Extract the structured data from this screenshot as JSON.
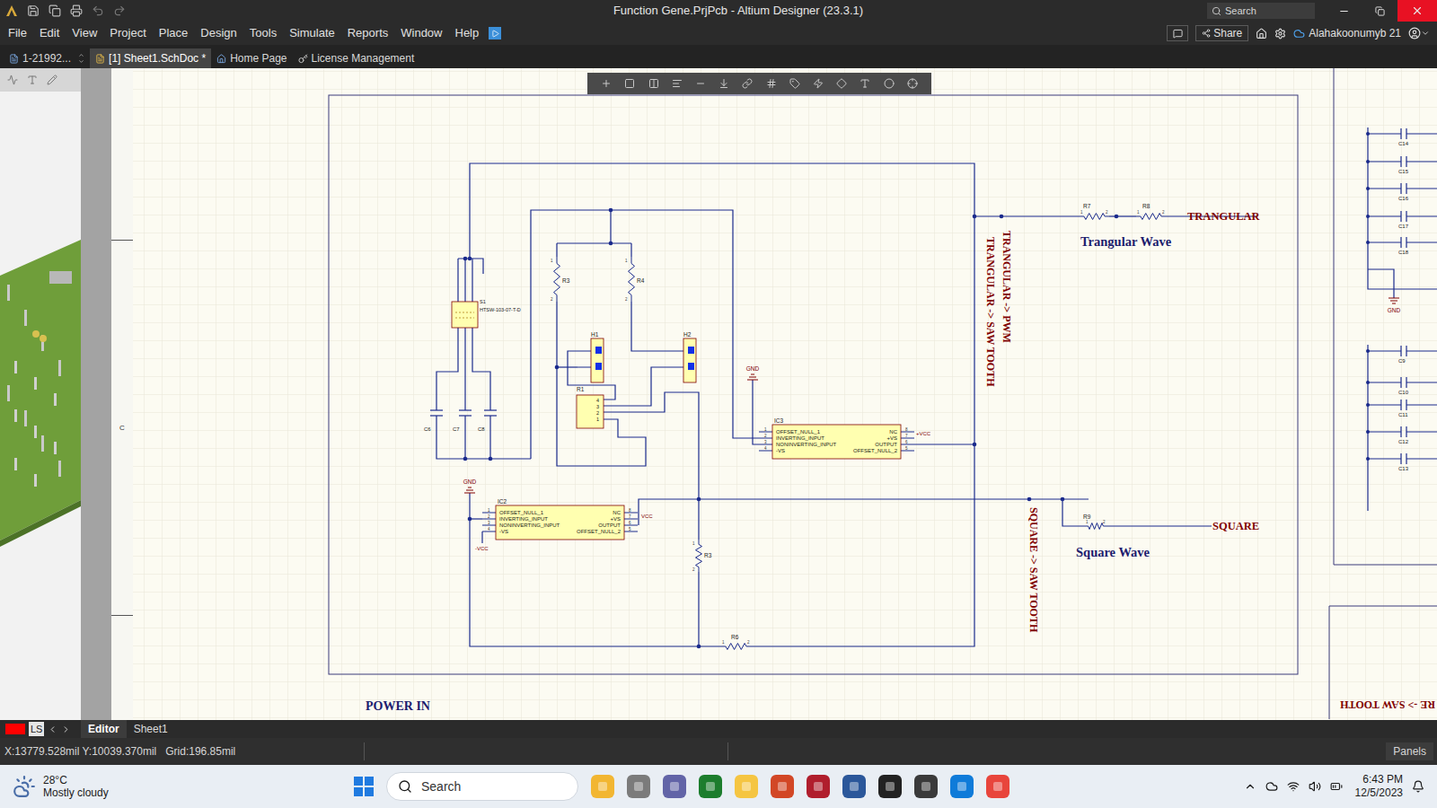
{
  "window": {
    "title": "Function Gene.PrjPcb - Altium Designer (23.3.1)",
    "search": "Search"
  },
  "menu": [
    "File",
    "Edit",
    "View",
    "Project",
    "Place",
    "Design",
    "Tools",
    "Simulate",
    "Reports",
    "Window",
    "Help"
  ],
  "header_right": {
    "share": "Share",
    "user": "Alahakoonumyb 21"
  },
  "doc_tabs": [
    {
      "label": "1-21992...",
      "selected": false
    },
    {
      "label": "[1] Sheet1.SchDoc *",
      "selected": true
    },
    {
      "label": "Home Page",
      "selected": false
    },
    {
      "label": "License Management",
      "selected": false
    }
  ],
  "ruler": {
    "label": "C"
  },
  "schematic": {
    "nets": [
      {
        "label": "TRANGULAR",
        "title": "Trangular Wave"
      },
      {
        "label": "SQUARE",
        "title": "Square Wave"
      }
    ],
    "vertical_labels": [
      "TRANGULAR -> PWM",
      "TRANGULAR -> SAW TOOTH",
      "SQUARE -> SAW TOOTH"
    ],
    "flipped_label": "RE -> SAW TOOTH",
    "sheet_label": "POWER IN",
    "resistors": [
      {
        "designator": "R3"
      },
      {
        "designator": "R4"
      },
      {
        "designator": "R3"
      },
      {
        "designator": "R6"
      },
      {
        "designator": "R7"
      },
      {
        "designator": "R8"
      },
      {
        "designator": "R9"
      }
    ],
    "resistor_pins": [
      "1",
      "2"
    ],
    "headers": [
      {
        "designator": "H1"
      },
      {
        "designator": "H2"
      }
    ],
    "connector": {
      "designator": "R1",
      "pins": [
        "4",
        "3",
        "2",
        "1"
      ]
    },
    "switch": {
      "designator": "S1",
      "part": "HTSW-103-07-T-D"
    },
    "capacitors": [
      "C6",
      "C7",
      "C8"
    ],
    "ics": [
      {
        "designator": "IC3",
        "power": "+VCC"
      },
      {
        "designator": "IC2",
        "power": "VCC",
        "neg": "-VCC"
      }
    ],
    "ic_pins": {
      "left": [
        {
          "num": "1",
          "name": "OFFSET_NULL_1"
        },
        {
          "num": "2",
          "name": "INVERTING_INPUT"
        },
        {
          "num": "3",
          "name": "NONINVERTING_INPUT"
        },
        {
          "num": "4",
          "name": "-VS"
        }
      ],
      "right": [
        {
          "num": "8",
          "name": "NC"
        },
        {
          "num": "7",
          "name": "+VS"
        },
        {
          "num": "6",
          "name": "OUTPUT"
        },
        {
          "num": "5",
          "name": "OFFSET_NULL_2"
        }
      ]
    },
    "ground": "GND",
    "side_sheet": {
      "capacitors_top": [
        "C14",
        "C15",
        "C16",
        "C17",
        "C18"
      ],
      "capacitors_bottom": [
        "C9",
        "C10",
        "C11",
        "C12",
        "C13"
      ]
    }
  },
  "bottom_tabs": {
    "layer": {
      "label": "LS",
      "color": "#ff0000"
    },
    "tabs": [
      {
        "label": "Editor",
        "selected": true
      },
      {
        "label": "Sheet1",
        "selected": false
      }
    ]
  },
  "status_bar": {
    "coords": "X:13779.528mil Y:10039.370mil",
    "grid": "Grid:196.85mil",
    "panels": "Panels"
  },
  "taskbar": {
    "temp": "28°C",
    "weather": "Mostly cloudy",
    "search": "Search",
    "time": "6:43 PM",
    "date": "12/5/2023"
  }
}
